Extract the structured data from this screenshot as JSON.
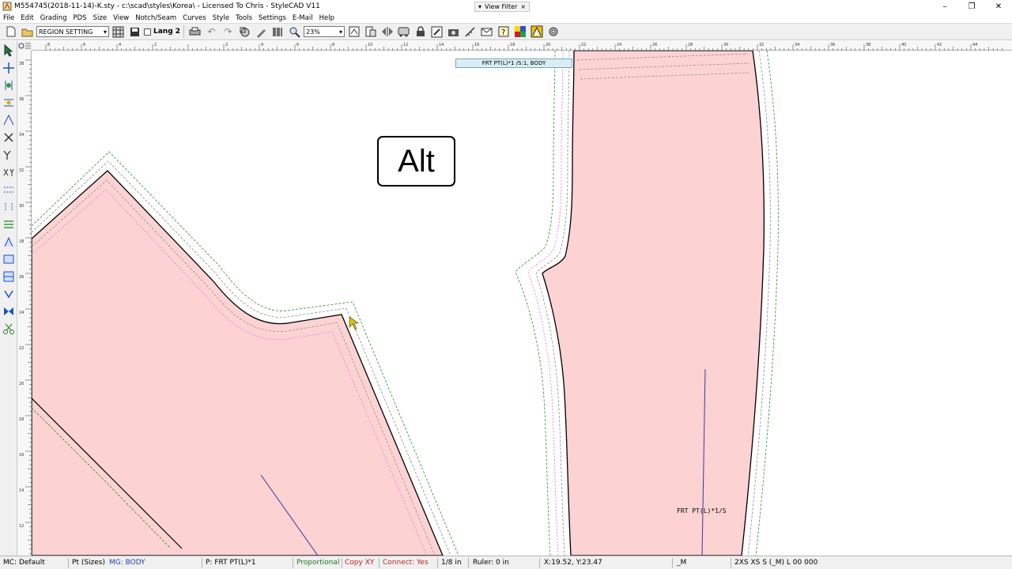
{
  "window": {
    "title": "M554745(2018-11-14)-K.sty - c:\\scad\\styles\\Korea\\ - Licensed To Chris - StyleCAD V11",
    "view_filter": "View Filter"
  },
  "menu": [
    "File",
    "Edit",
    "Grading",
    "PDS",
    "Size",
    "View",
    "Notch/Seam",
    "Curves",
    "Style",
    "Tools",
    "Settings",
    "E-Mail",
    "Help"
  ],
  "toolbar": {
    "region_select": "REGION SETTING",
    "lang_label": "Lang 2",
    "zoom_value": "23%"
  },
  "ruler": {
    "top_ticks": [
      "8",
      "6",
      "4",
      "2",
      "",
      "2",
      "4",
      "6",
      "8",
      "10",
      "12",
      "14",
      "16",
      "18",
      "20",
      "22",
      "24",
      "26",
      "28",
      "30",
      "32",
      "34",
      "36",
      "38",
      "40",
      "42",
      "44"
    ],
    "left_ticks": [
      "38",
      "36",
      "34",
      "32",
      "30",
      "28",
      "26",
      "24",
      "22",
      "20",
      "18",
      "16",
      "14",
      "12"
    ]
  },
  "canvas": {
    "piece_label": "FRT PT(L)*1 /S:1, BODY",
    "alt_key": "Alt",
    "piece_annotation": "FRT PT(L)*1/S",
    "fill_color": "#fcd2d2",
    "outline_color": "#000000",
    "seam_color": "#2e8b2e",
    "grain_color": "#3b3b9a"
  },
  "status": {
    "mc": "MC: Default",
    "pt": "Pt (Sizes)",
    "mg": "MG: BODY",
    "p": "P: FRT PT(L)*1",
    "proportional": "Proportional",
    "copy": "Copy XY",
    "connect": "Connect: Yes",
    "fraction": "1/8 in",
    "ruler": "Ruler: 0 in",
    "coords": "X:19.52, Y:23.47",
    "m": "_M",
    "sizes": "2XS XS S (_M) L 00 000",
    "color_mg": "#1f3fb0",
    "color_proportional": "#1b7a1b",
    "color_copy": "#c81e1e",
    "color_connect": "#c81e1e"
  }
}
